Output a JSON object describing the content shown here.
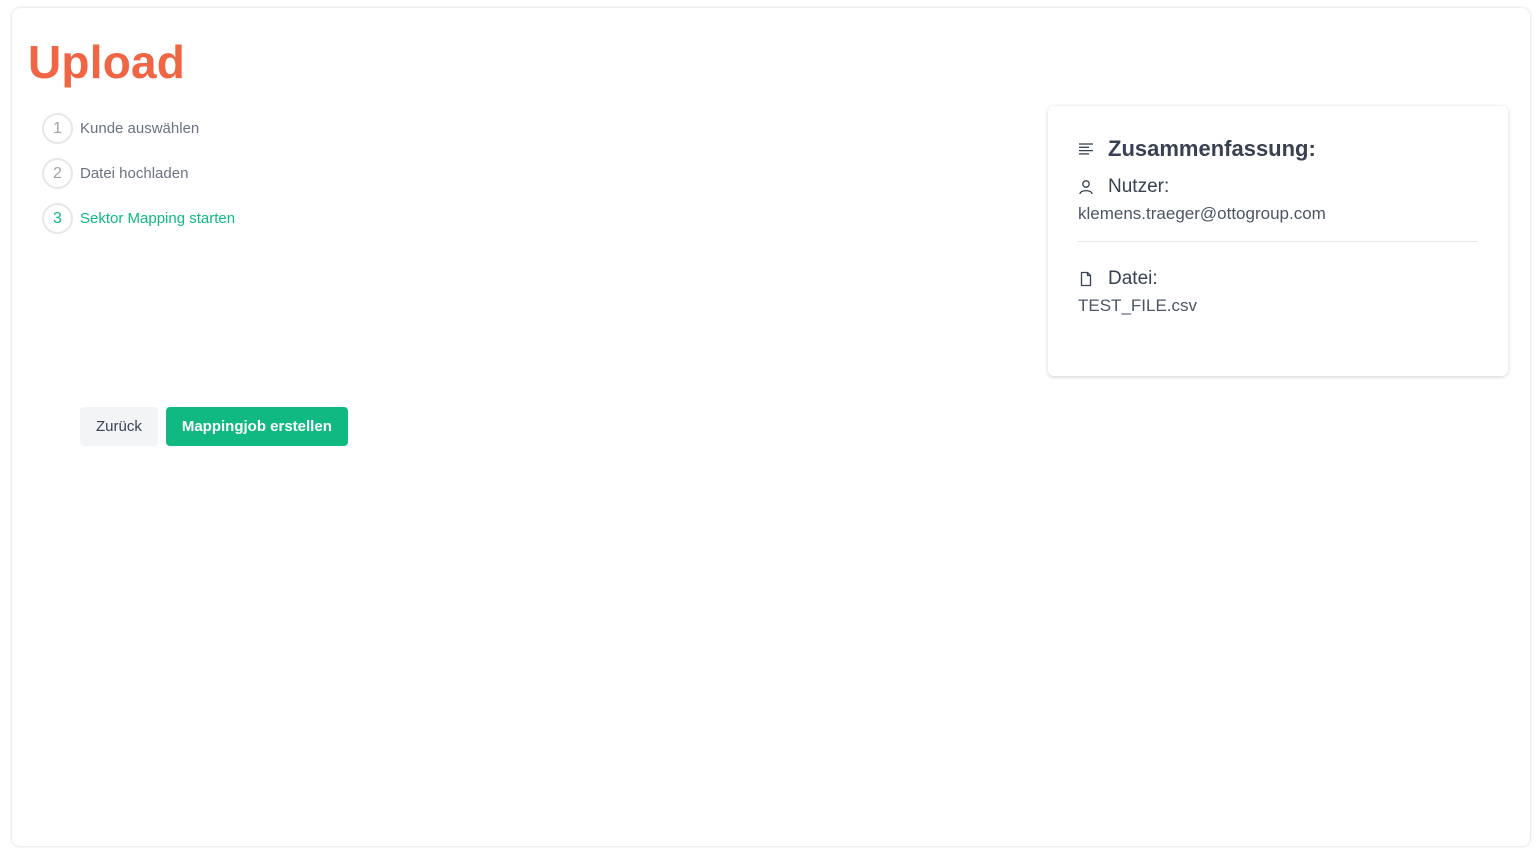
{
  "page": {
    "title": "Upload"
  },
  "colors": {
    "title": "#f06543",
    "accent_green": "#10b981",
    "muted_text": "#6b7280"
  },
  "steps": [
    {
      "number": "1",
      "label": "Kunde auswählen",
      "state": "done"
    },
    {
      "number": "2",
      "label": "Datei hochladen",
      "state": "done"
    },
    {
      "number": "3",
      "label": "Sektor Mapping starten",
      "state": "active"
    }
  ],
  "summary": {
    "title": "Zusammenfassung:",
    "title_icon": "list-icon",
    "user_label": "Nutzer:",
    "user_icon": "user-icon",
    "user_value": "klemens.traeger@ottogroup.com",
    "file_label": "Datei:",
    "file_icon": "file-icon",
    "file_value": "TEST_FILE.csv"
  },
  "actions": {
    "back_label": "Zurück",
    "create_label": "Mappingjob erstellen"
  }
}
